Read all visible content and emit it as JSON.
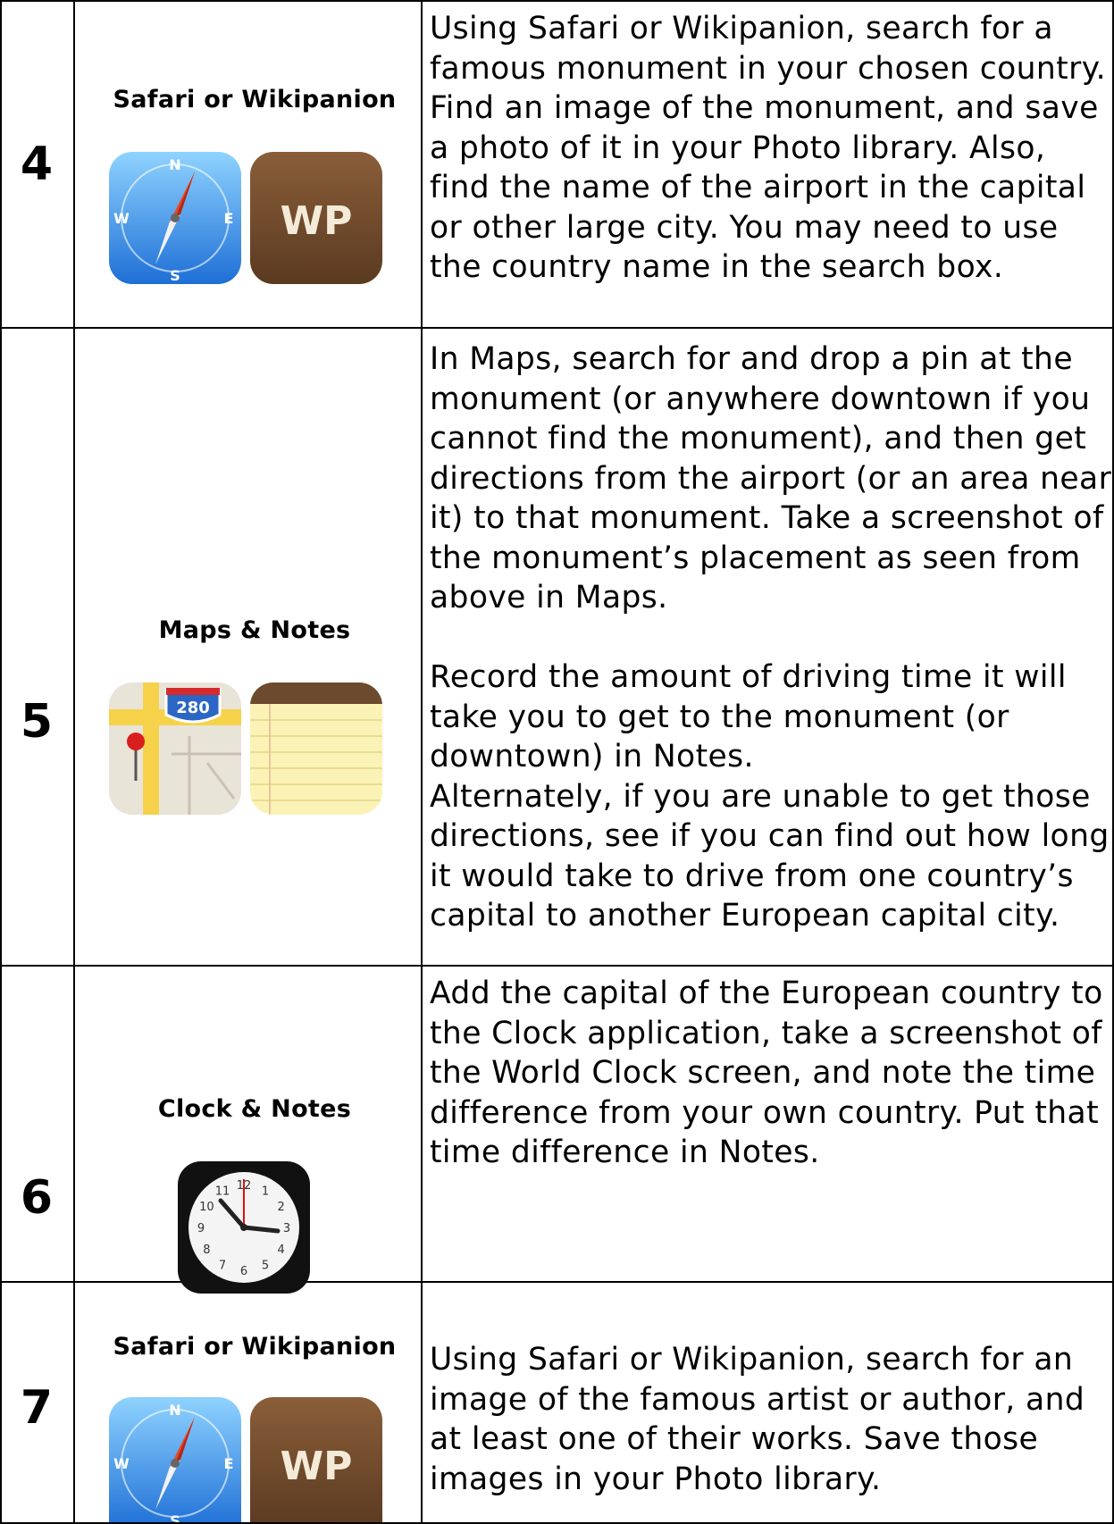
{
  "rows": [
    {
      "number": "4",
      "apps": "Safari or Wikipanion",
      "icons": [
        "safari-icon",
        "wikipanion-icon"
      ],
      "description": "Using Safari or Wikipanion, search for a famous monument in your chosen country. Find an image of the monument, and save a photo of it in your Photo library. Also, find the name of the airport in the capital or other large city. You may need to use the country name in the search box."
    },
    {
      "number": "5",
      "apps": "Maps & Notes",
      "icons": [
        "maps-icon",
        "notes-icon"
      ],
      "maps_shield": "280",
      "description": "In Maps, search for and drop a pin at the monument (or anywhere downtown if you cannot find the monument), and then get directions from the airport (or an area near it) to that monument.  Take a screenshot of the monument’s placement as seen from above in Maps.\n\nRecord the amount of driving time it will take you to get to the monument (or downtown) in Notes.\nAlternately, if you are unable to get those directions, see if you can find out how long it would take to drive from one country’s capital to another European capital city."
    },
    {
      "number": "6",
      "apps": "Clock & Notes",
      "icons": [
        "clock-icon"
      ],
      "clock_numerals": [
        "12",
        "1",
        "2",
        "3",
        "4",
        "5",
        "6",
        "7",
        "8",
        "9",
        "10",
        "11"
      ],
      "description": "Add the capital of the European country to the Clock application, take a screenshot of the World Clock screen, and note the time difference from your own country. Put that time difference in Notes."
    },
    {
      "number": "7",
      "apps": "Safari or Wikipanion",
      "icons": [
        "safari-icon",
        "wikipanion-icon"
      ],
      "description": "Using Safari or Wikipanion, search for an image of the famous artist or author, and at least one of their works. Save those images in your Photo library."
    }
  ],
  "icon_text": {
    "wikipanion": "WP",
    "compass_letters": [
      "N",
      "E",
      "S",
      "W"
    ]
  }
}
